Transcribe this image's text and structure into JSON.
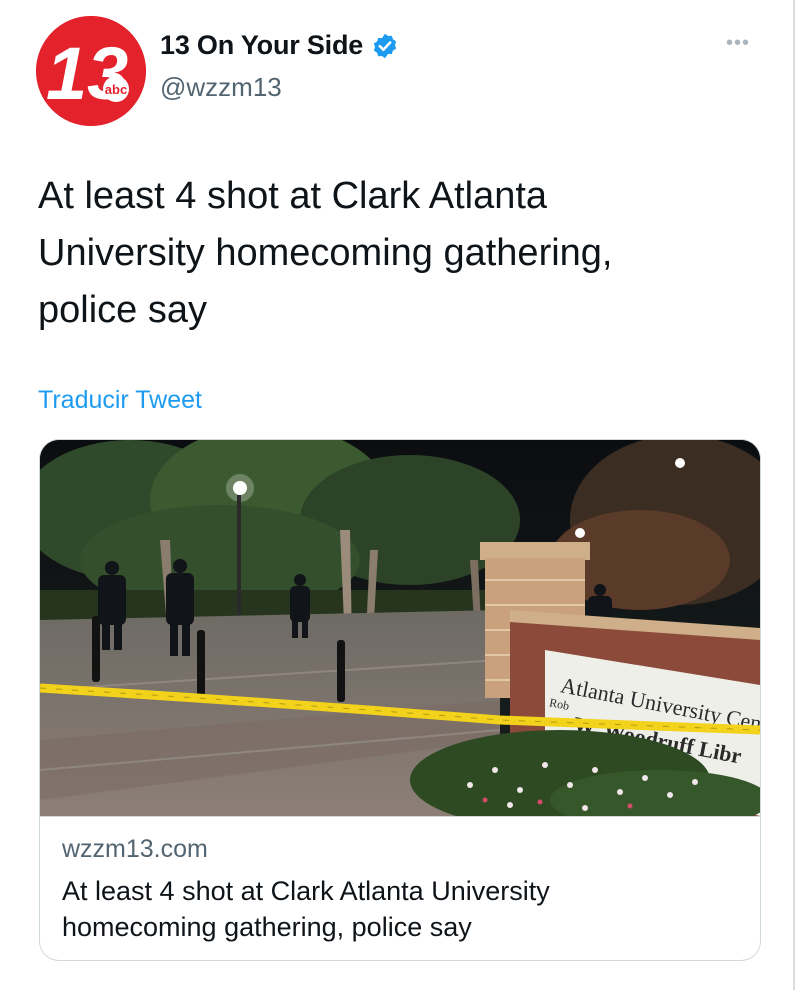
{
  "tweet": {
    "author": {
      "display_name": "13 On Your Side",
      "handle": "@wzzm13",
      "verified": true,
      "avatar_text": "13",
      "avatar_badge": "abc"
    },
    "text_lines": [
      "At least 4 shot at Clark Atlanta",
      "University homecoming gathering,",
      "police say"
    ],
    "translate_label": "Traducir Tweet",
    "more_label": "•••"
  },
  "card": {
    "domain": "wzzm13.com",
    "title_lines": [
      "At least 4 shot at Clark Atlanta University",
      "homecoming gathering, police say"
    ],
    "image": {
      "sign_lines": [
        "Atlanta University Cen",
        "W. Woodruff Libr"
      ],
      "sign_small": "Rob",
      "description_icon": "crime-scene-photo"
    }
  },
  "colors": {
    "accent_blue": "#1d9bf0",
    "avatar_red": "#e3222c",
    "secondary_text": "#536471",
    "tape_yellow": "#f2d21b"
  }
}
